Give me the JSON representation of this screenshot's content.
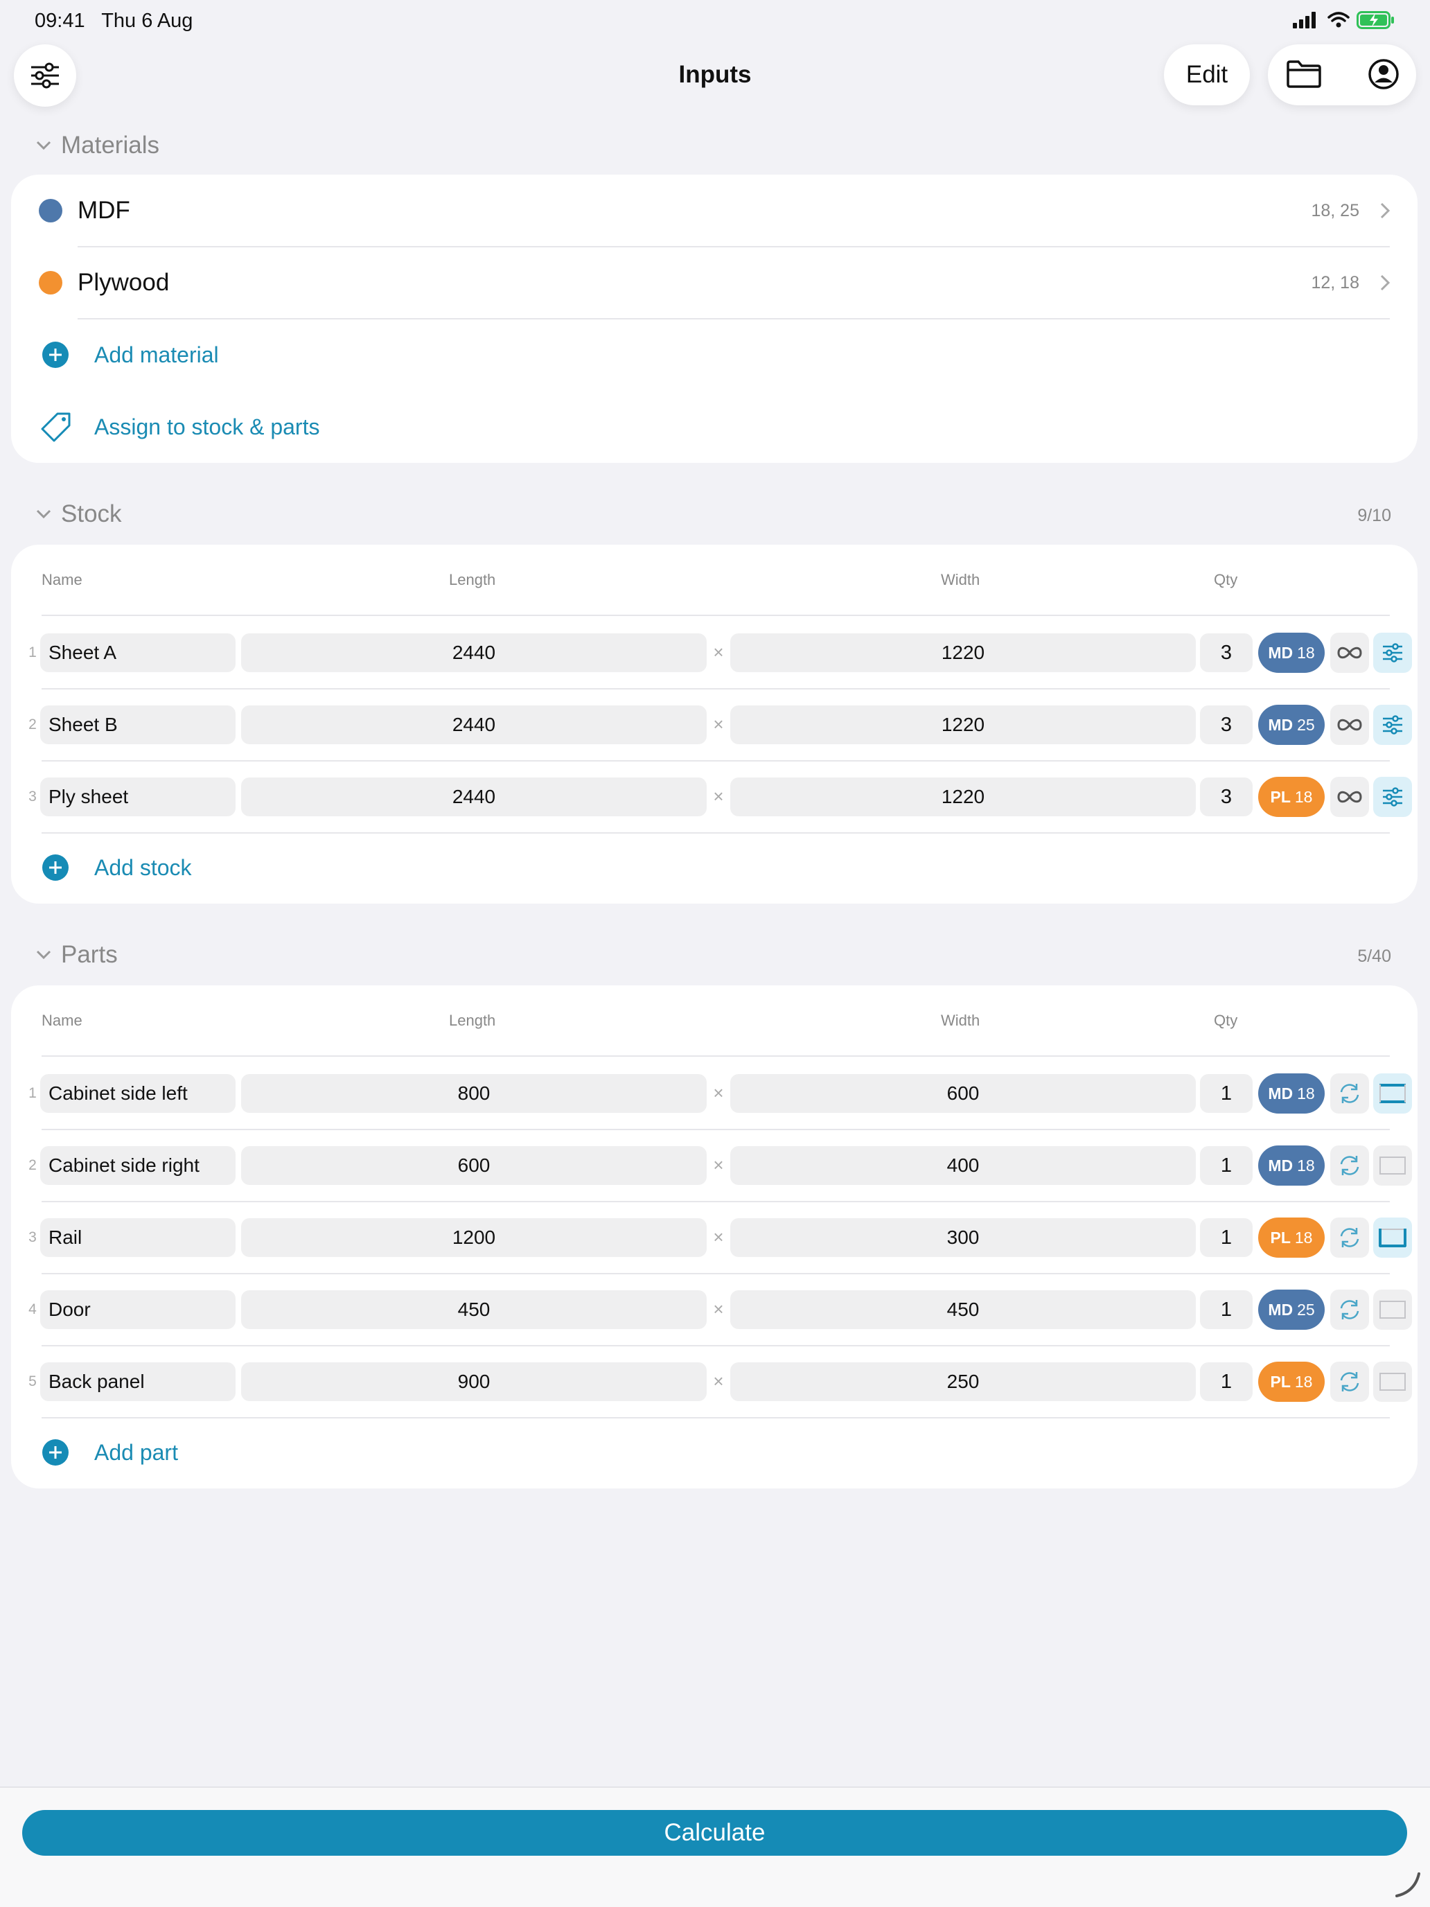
{
  "status_bar": {
    "time_date": "09:41   Thu 6 Aug"
  },
  "header": {
    "title": "Inputs",
    "edit_label": "Edit"
  },
  "colors": {
    "accent": "#158bb6",
    "mdf": "#4e78ab",
    "plywood": "#f39130"
  },
  "materials": {
    "heading": "Materials",
    "items": [
      {
        "name": "MDF",
        "sizes": "18, 25",
        "color": "#4e78ab"
      },
      {
        "name": "Plywood",
        "sizes": "12, 18",
        "color": "#f39130"
      }
    ],
    "add_label": "Add material",
    "assign_label": "Assign to stock & parts"
  },
  "stock": {
    "heading": "Stock",
    "count": "9/10",
    "columns": {
      "name": "Name",
      "length": "Length",
      "width": "Width",
      "qty": "Qty"
    },
    "rows": [
      {
        "num": "1",
        "name": "Sheet A",
        "length": "2440",
        "width": "1220",
        "qty": "3",
        "mat": "MD",
        "thick": "18",
        "kind": "mdf"
      },
      {
        "num": "2",
        "name": "Sheet B",
        "length": "2440",
        "width": "1220",
        "qty": "3",
        "mat": "MD",
        "thick": "25",
        "kind": "mdf"
      },
      {
        "num": "3",
        "name": "Ply sheet",
        "length": "2440",
        "width": "1220",
        "qty": "3",
        "mat": "PL",
        "thick": "18",
        "kind": "ply"
      }
    ],
    "add_label": "Add stock"
  },
  "parts": {
    "heading": "Parts",
    "count": "5/40",
    "columns": {
      "name": "Name",
      "length": "Length",
      "width": "Width",
      "qty": "Qty"
    },
    "rows": [
      {
        "num": "1",
        "name": "Cabinet side left",
        "length": "800",
        "width": "600",
        "qty": "1",
        "mat": "MD",
        "thick": "18",
        "kind": "mdf",
        "edge": "top-bottom"
      },
      {
        "num": "2",
        "name": "Cabinet side right",
        "length": "600",
        "width": "400",
        "qty": "1",
        "mat": "MD",
        "thick": "18",
        "kind": "mdf",
        "edge": "none"
      },
      {
        "num": "3",
        "name": "Rail",
        "length": "1200",
        "width": "300",
        "qty": "1",
        "mat": "PL",
        "thick": "18",
        "kind": "ply",
        "edge": "three-sides"
      },
      {
        "num": "4",
        "name": "Door",
        "length": "450",
        "width": "450",
        "qty": "1",
        "mat": "MD",
        "thick": "25",
        "kind": "mdf",
        "edge": "none"
      },
      {
        "num": "5",
        "name": "Back panel",
        "length": "900",
        "width": "250",
        "qty": "1",
        "mat": "PL",
        "thick": "18",
        "kind": "ply",
        "edge": "none"
      }
    ],
    "add_label": "Add part"
  },
  "calculate_label": "Calculate"
}
